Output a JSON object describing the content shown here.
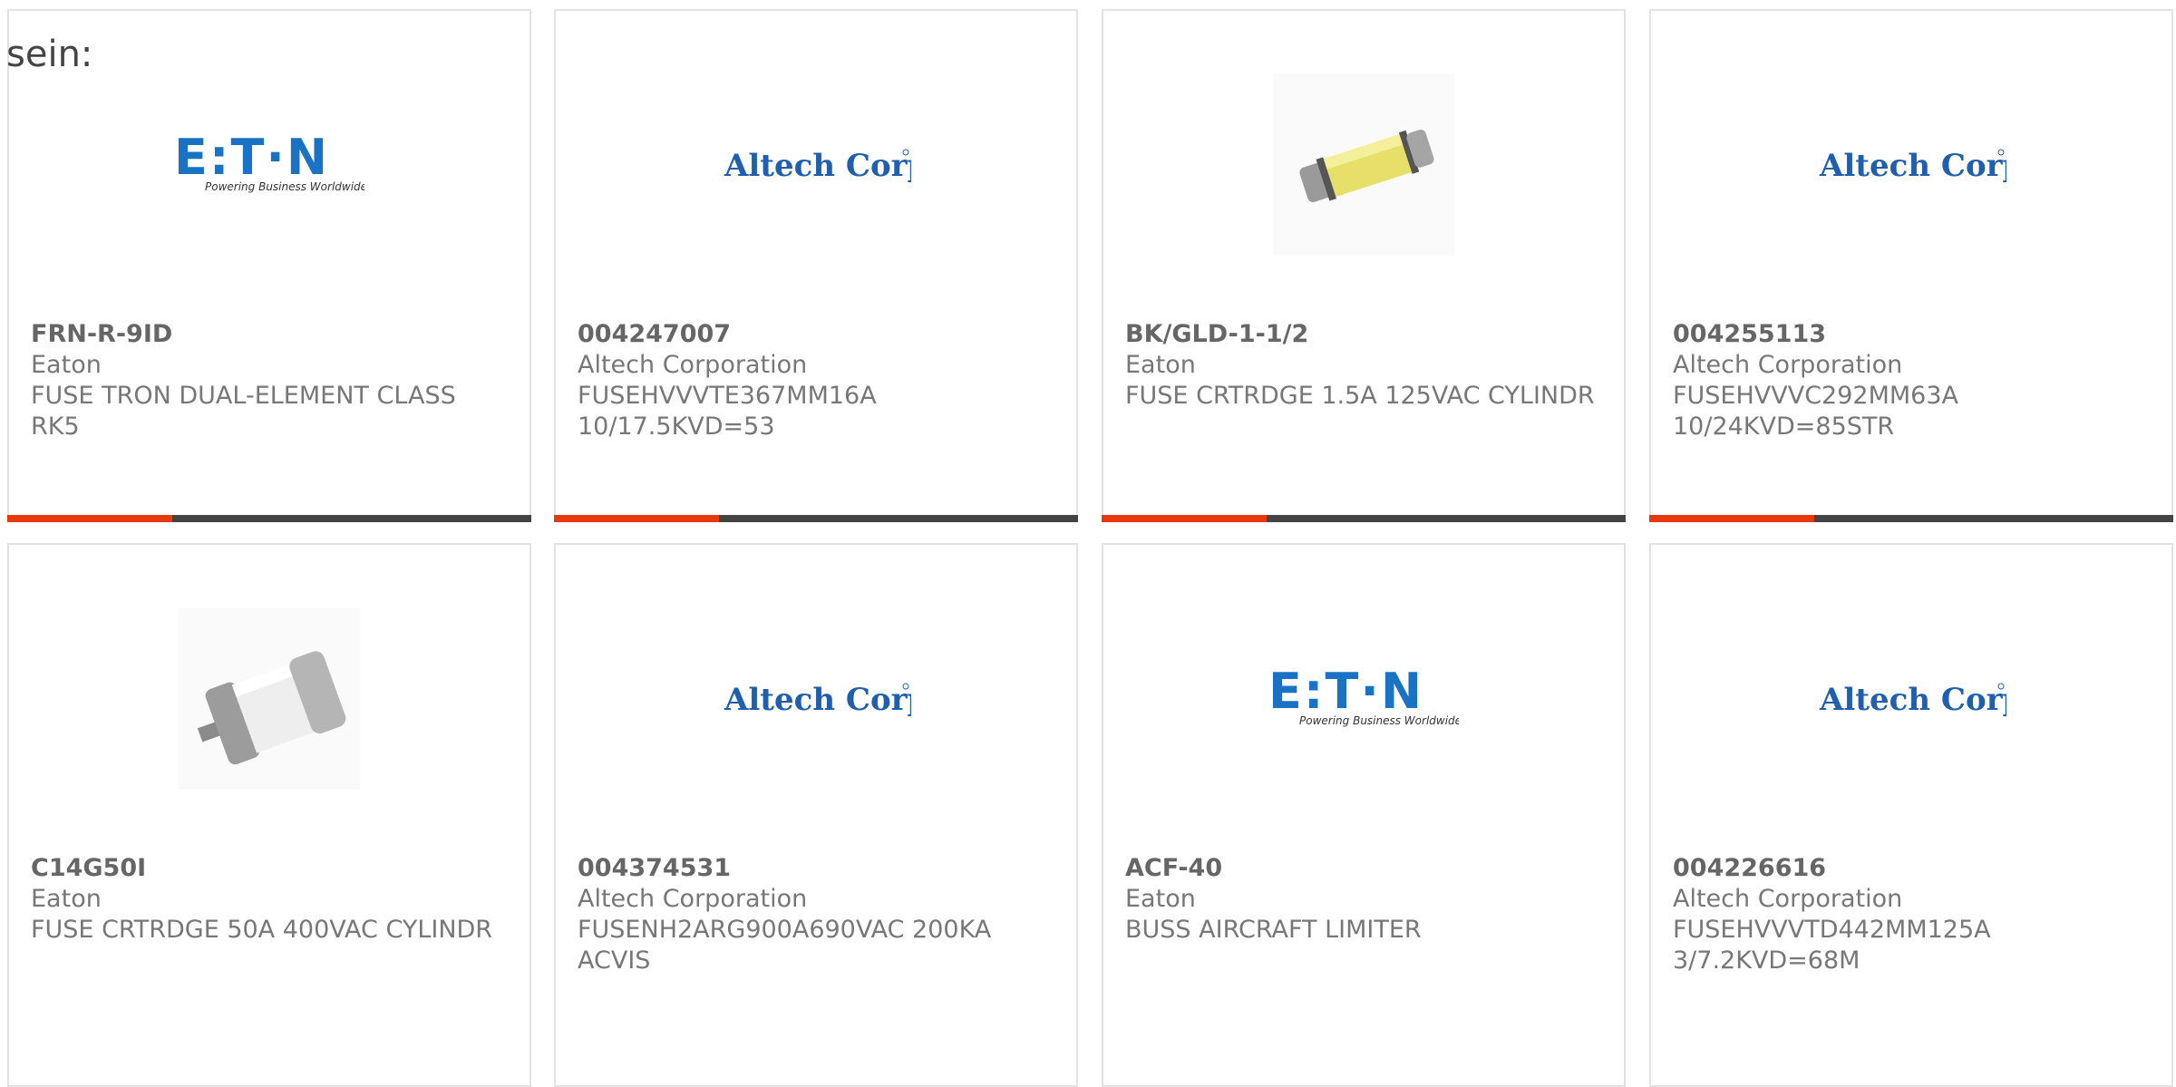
{
  "lead_text": "sein:",
  "products": [
    {
      "part_number": "FRN-R-9ID",
      "manufacturer": "Eaton",
      "description": "FUSE TRON DUAL-ELEMENT CLASS RK5",
      "image": "eaton-logo",
      "logo_text": "E:T·N",
      "logo_tagline": "Powering Business Worldwide"
    },
    {
      "part_number": "004247007",
      "manufacturer": "Altech Corporation",
      "description": "FUSEHVVVTE367MM16A 10/17.5KVD=53",
      "image": "altech-logo",
      "logo_text": "Altech Corp."
    },
    {
      "part_number": "BK/GLD-1-1/2",
      "manufacturer": "Eaton",
      "description": "FUSE CRTRDGE 1.5A 125VAC CYLINDR",
      "image": "yellow-cartridge-fuse"
    },
    {
      "part_number": "004255113",
      "manufacturer": "Altech Corporation",
      "description": "FUSEHVVVC292MM63A 10/24KVD=85STR",
      "image": "altech-logo",
      "logo_text": "Altech Corp."
    },
    {
      "part_number": "C14G50I",
      "manufacturer": "Eaton",
      "description": "FUSE CRTRDGE 50A 400VAC CYLINDR",
      "image": "cylinder-fuse"
    },
    {
      "part_number": "004374531",
      "manufacturer": "Altech Corporation",
      "description": "FUSENH2ARG900A690VAC 200KA ACVIS",
      "image": "altech-logo",
      "logo_text": "Altech Corp."
    },
    {
      "part_number": "ACF-40",
      "manufacturer": "Eaton",
      "description": "BUSS AIRCRAFT LIMITER",
      "image": "eaton-logo",
      "logo_text": "E:T·N",
      "logo_tagline": "Powering Business Worldwide"
    },
    {
      "part_number": "004226616",
      "manufacturer": "Altech Corporation",
      "description": "FUSEHVVVTD442MM125A 3/7.2KVD=68M",
      "image": "altech-logo",
      "logo_text": "Altech Corp."
    }
  ],
  "colors": {
    "accent": "#e8380d",
    "bar": "#444444",
    "eaton_blue": "#1a72c4",
    "altech_blue": "#1f5fae"
  }
}
